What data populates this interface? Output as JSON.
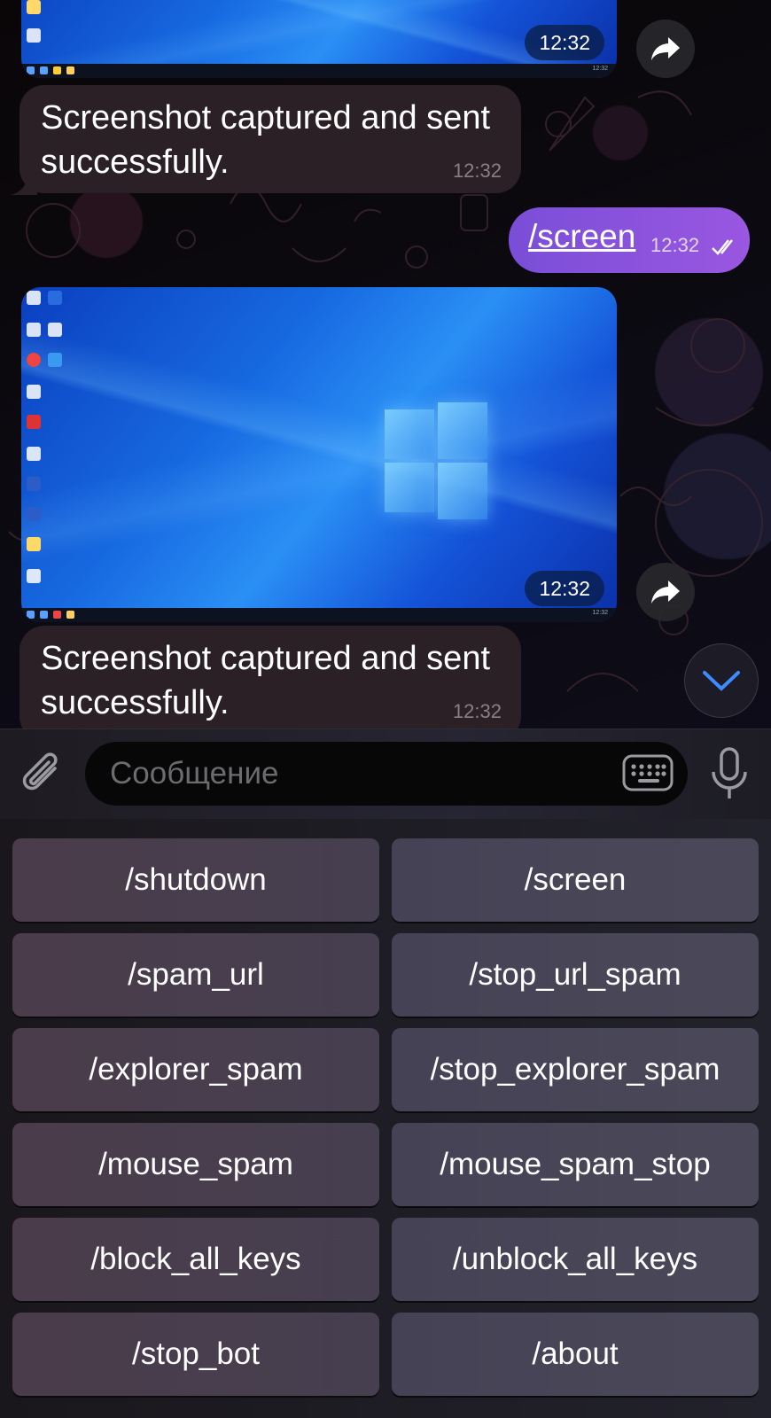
{
  "messages": {
    "photo_top": {
      "time": "12:32"
    },
    "bot_reply_1": {
      "text": "Screenshot captured and sent successfully.",
      "time": "12:32"
    },
    "user_command": {
      "text": "/screen",
      "time": "12:32"
    },
    "photo_main": {
      "time": "12:32"
    },
    "bot_reply_2": {
      "text": "Screenshot captured and sent successfully.",
      "time": "12:32"
    }
  },
  "input": {
    "placeholder": "Сообщение"
  },
  "keyboard": {
    "rows": [
      [
        "/shutdown",
        "/screen"
      ],
      [
        "/spam_url",
        "/stop_url_spam"
      ],
      [
        "/explorer_spam",
        "/stop_explorer_spam"
      ],
      [
        "/mouse_spam",
        "/mouse_spam_stop"
      ],
      [
        "/block_all_keys",
        "/unblock_all_keys"
      ],
      [
        "/stop_bot",
        "/about"
      ]
    ]
  },
  "colors": {
    "outgoing_bubble": "#8a52dc",
    "incoming_bubble": "#2a2026",
    "accent": "#3d8bff"
  },
  "icons": [
    "forward-icon",
    "chevron-down-icon",
    "paperclip-icon",
    "keyboard-icon",
    "microphone-icon",
    "double-check-icon"
  ]
}
